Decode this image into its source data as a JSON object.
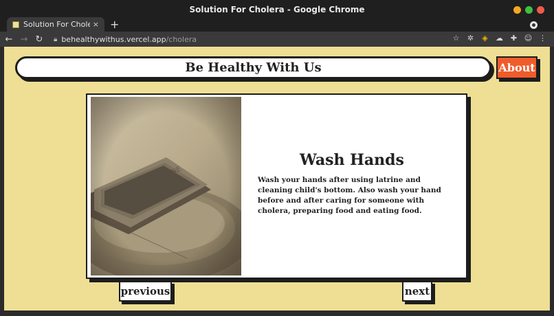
{
  "window": {
    "title": "Solution For Cholera - Google Chrome",
    "controls": {
      "minimize_color": "#f5a623",
      "maximize_color": "#3fbf3f",
      "close_color": "#ef5a4a"
    }
  },
  "browser": {
    "tab": {
      "label": "Solution For Cholera",
      "close": "×"
    },
    "new_tab": "+",
    "url_domain": "behealthywithus.vercel.app",
    "url_path": "/cholera",
    "icons": [
      "star-icon",
      "gear-icon",
      "shield-icon",
      "cloud-icon",
      "puzzle-icon",
      "profile-icon",
      "menu-icon"
    ]
  },
  "site": {
    "brand": "Be Healthy With Us",
    "about": "About",
    "colors": {
      "background": "#eedf94",
      "accent": "#ef5c2b"
    }
  },
  "card": {
    "title": "Wash Hands",
    "body": "Wash your hands after using latrine and cleaning child's bottom. Also wash your hand before and after caring for someone with cholera, preparing food and eating food.",
    "image_icon": "soap-bar-photo-icon"
  },
  "navigation": {
    "previous": "previous",
    "next": "next"
  }
}
